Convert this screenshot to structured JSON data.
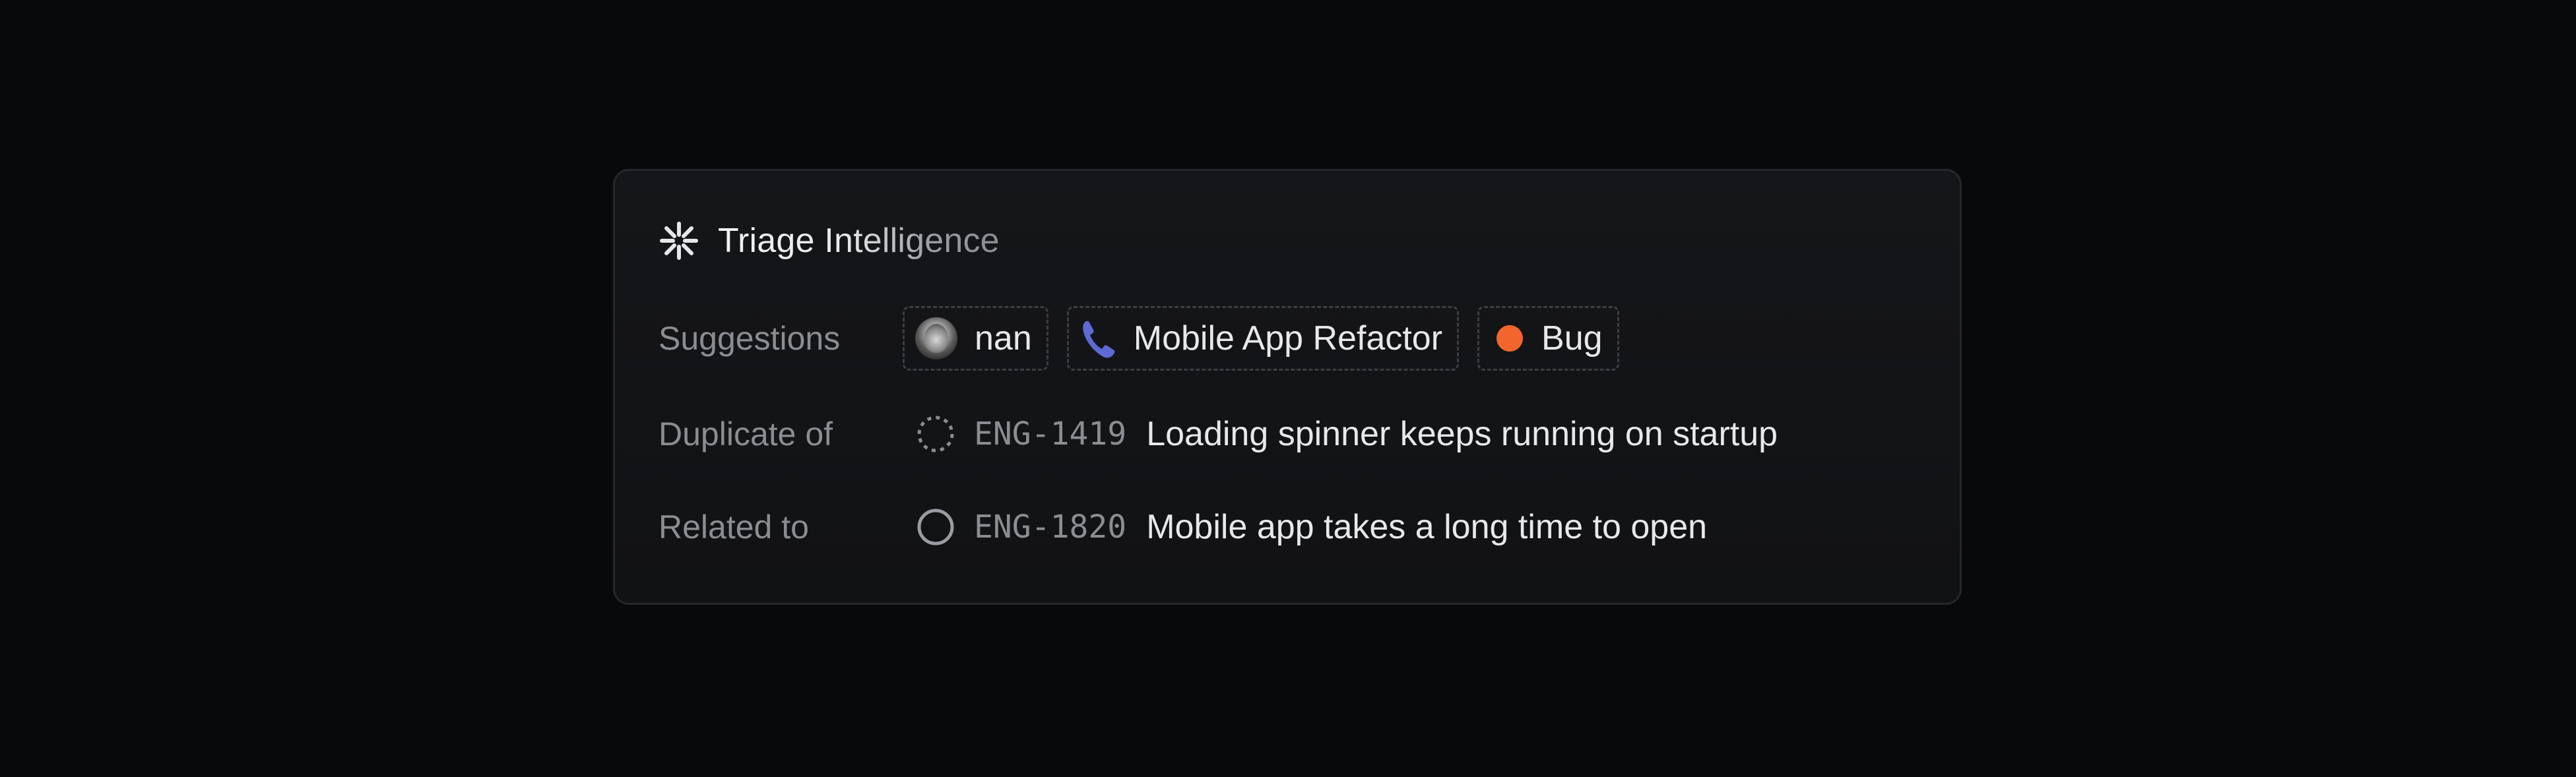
{
  "panel": {
    "title": "Triage Intelligence",
    "icon": "sparkle-burst-icon"
  },
  "suggestions": {
    "label": "Suggestions",
    "assignee": {
      "name": "nan",
      "icon": "avatar"
    },
    "project": {
      "name": "Mobile App Refactor",
      "icon": "phone-icon",
      "color": "#5e6ad2"
    },
    "label_chip": {
      "name": "Bug",
      "icon": "dot",
      "color": "#f2662d"
    }
  },
  "duplicate": {
    "label": "Duplicate of",
    "issue_id": "ENG-1419",
    "issue_title": "Loading spinner keeps running on startup",
    "status_icon": "dashed-circle-icon"
  },
  "related": {
    "label": "Related to",
    "issue_id": "ENG-1820",
    "issue_title": "Mobile app takes a long time to open",
    "status_icon": "open-circle-icon"
  },
  "colors": {
    "background": "#08090b",
    "card": "#131417",
    "muted_text": "#8b8d93",
    "text": "#e7e8ea"
  }
}
